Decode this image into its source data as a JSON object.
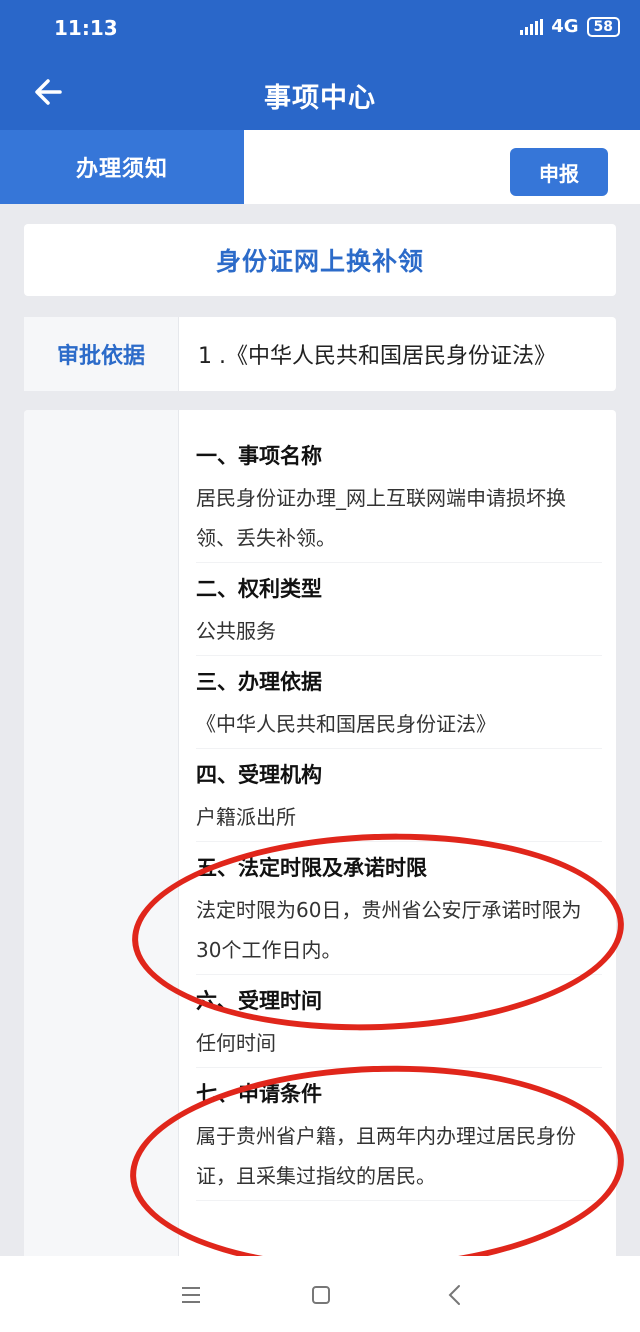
{
  "status": {
    "time": "11:13",
    "network": "4G",
    "battery": "58"
  },
  "header": {
    "title": "事项中心"
  },
  "tabs": {
    "active": "办理须知",
    "report_button": "申报"
  },
  "item_title": "身份证网上换补领",
  "basis": {
    "label": "审批依据",
    "text": "1 .《中华人民共和国居民身份证法》"
  },
  "sections": [
    {
      "heading": "一、事项名称",
      "text": "居民身份证办理_网上互联网端申请损坏换领、丢失补领。"
    },
    {
      "heading": "二、权利类型",
      "text": "公共服务"
    },
    {
      "heading": "三、办理依据",
      "text": "《中华人民共和国居民身份证法》"
    },
    {
      "heading": "四、受理机构",
      "text": "户籍派出所"
    },
    {
      "heading": "五、法定时限及承诺时限",
      "text": "法定时限为60日，贵州省公安厅承诺时限为30个工作日内。"
    },
    {
      "heading": "六、受理时间",
      "text": "任何时间"
    },
    {
      "heading": "七、申请条件",
      "text": "属于贵州省户籍，且两年内办理过居民身份证，且采集过指纹的居民。"
    }
  ],
  "colors": {
    "brand": "#2a67c9",
    "accent": "#3676d8",
    "annotation": "#e0261b"
  },
  "icons": {
    "back": "back-arrow-icon",
    "menu": "menu-icon",
    "home": "home-icon",
    "nav_back": "nav-back-icon"
  }
}
